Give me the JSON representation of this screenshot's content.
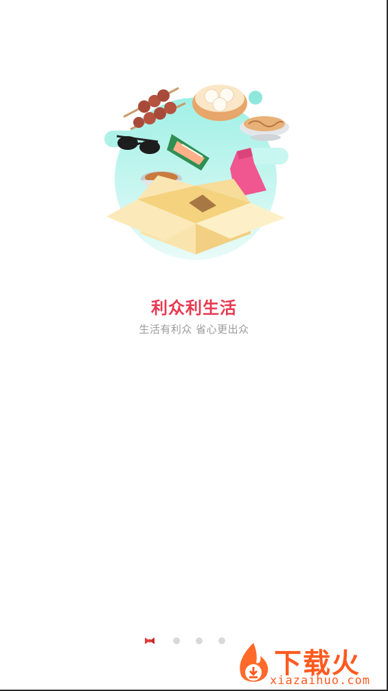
{
  "onboarding": {
    "title": "利众利生活",
    "subtitle": "生活有利众   省心更出众"
  },
  "pager": {
    "total": 4,
    "active_index": 0
  },
  "watermark": {
    "brand": "下载火",
    "domain": "xiazaihuo.com"
  },
  "colors": {
    "accent": "#e8384f",
    "subtitle": "#9a9a9a",
    "blob": "#7ee3d6",
    "box": "#f7e3a6",
    "watermark": "#ff5a1f"
  },
  "icons": {
    "active_dot": "bow-icon",
    "watermark_logo": "flame-download-icon"
  }
}
